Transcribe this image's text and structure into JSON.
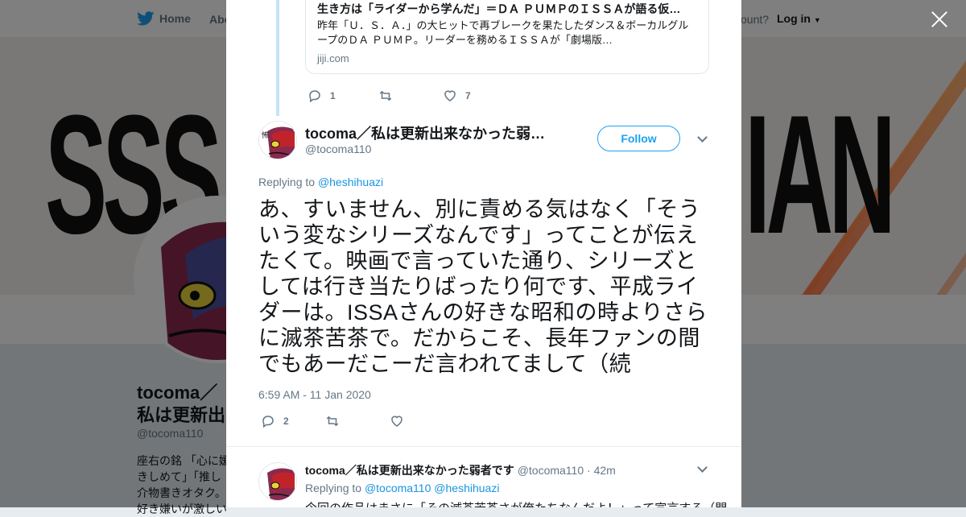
{
  "nav": {
    "home_label": "Home",
    "about_label": "Abo",
    "account_label": "ccount?",
    "login_label": "Log in"
  },
  "banner": {
    "left_text": "SSS",
    "right_text": "IAN"
  },
  "profile": {
    "name": "tocoma／私は更新出来なかった弱者です",
    "handle": "@tocoma110",
    "bio": "座右の銘 「心に媛 きしめて」「推し 介物書きオタク。 好き嫌いが激しい"
  },
  "card": {
    "title": "生き方は「ライダーから学んだ」＝ＤＡ ＰＵＭＰのＩＳＳＡが語る仮…",
    "desc": "昨年「Ｕ．Ｓ．Ａ．」の大ヒットで再ブレークを果たしたダンス＆ボーカルグループのＤＡ ＰＵＭＰ。リーダーを務めるＩＳＳＡが「劇場版…",
    "url": "jiji.com"
  },
  "prev_actions": {
    "replies": "1",
    "retweets": "",
    "likes": "7"
  },
  "tweet": {
    "fullname": "tocoma／私は更新出来なかった弱…",
    "handle": "@tocoma110",
    "follow_label": "Follow",
    "replying_prefix": "Replying to",
    "replying_to": "@heshihuazi",
    "text": "あ、すいません、別に責める気はなく「そういう変なシリーズなんです」ってことが伝えたくて。映画で言っていた通り、シリーズとしては行き当たりばったり何です、平成ライダーは。ISSAさんの好きな昭和の時よりさらに滅茶苦茶で。だからこそ、長年ファンの間でもあーだこーだ言われてまして（続",
    "timestamp": "6:59 AM - 11 Jan 2020",
    "replies": "2",
    "retweets": "",
    "likes": ""
  },
  "reply": {
    "fullname": "tocoma／私は更新出来なかった弱者です",
    "handle": "@tocoma110",
    "time": "· 42m",
    "replying_prefix": "Replying to",
    "replying_to_1": "@tocoma110",
    "replying_to_2": "@heshihuazi",
    "text": "今回の作品はまさに「その滅茶苦茶さが俺たちなんだよ！」って宣言する（門"
  },
  "colors": {
    "accent": "#1da1f2",
    "link": "#1b95e0",
    "muted": "#657786"
  }
}
